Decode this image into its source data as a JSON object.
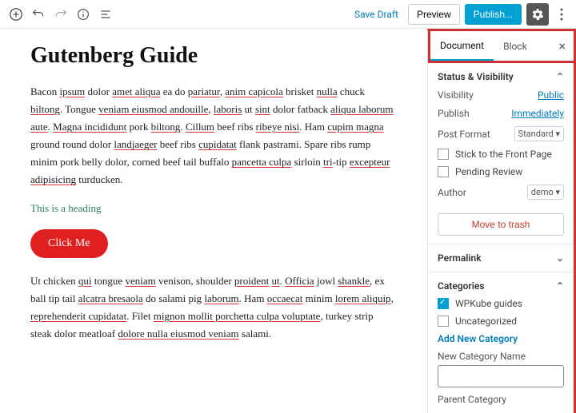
{
  "toolbar": {
    "save_draft": "Save Draft",
    "preview": "Preview",
    "publish": "Publish..."
  },
  "post": {
    "title": "Gutenberg Guide",
    "p1_html": "Bacon <span class='u'>ipsum</span> dolor <span class='u'>amet aliqua</span> ea do <span class='u'>pariatur</span>, <span class='u'>anim capicola</span> brisket <span class='u'>nulla</span> chuck <span class='u'>biltong</span>. Tongue <span class='u'>veniam eiusmod andouille</span>, <span class='u'>laboris</span> ut <span class='u'>sint</span> dolor fatback <span class='u'>aliqua laborum aute</span>. <span class='u'>Magna incididunt</span> pork <span class='u'>biltong</span>. <span class='u'>Cillum</span> beef ribs <span class='u'>ribeye nisi</span>. Ham <span class='u'>cupim magna</span> ground round dolor <span class='u'>landjaeger</span> beef ribs <span class='u'>cupidatat</span> flank pastrami. Spare ribs rump minim pork belly dolor, corned beef tail buffalo <span class='u'>pancetta culpa</span> sirloin <span class='u'>tri</span>-tip <span class='u'>excepteur adipisicing</span> turducken.",
    "heading_text": "This is a heading",
    "button_label": "Click Me",
    "p2_html": "Ut chicken <span class='u'>qui</span> tongue <span class='u'>veniam</span> venison, shoulder <span class='u'>proident</span> <span class='u'>ut</span>. <span class='u'>Officia</span> jowl <span class='u'>shankle</span>, ex ball tip tail <span class='u'>alcatra bresaola</span> do salami pig <span class='u'>laborum</span>. Ham <span class='u'>occaecat</span> minim <span class='u'>lorem aliquip</span>, <span class='u'>reprehenderit cupidatat</span>. Filet <span class='u'>mignon mollit porchetta culpa voluptate</span>, turkey strip steak dolor meatloaf <span class='u'>dolore nulla eiusmod veniam</span> salami."
  },
  "sidebar": {
    "tabs": {
      "document": "Document",
      "block": "Block"
    },
    "status": {
      "title": "Status & Visibility",
      "visibility": "Visibility",
      "visibility_val": "Public",
      "publish": "Publish",
      "publish_val": "Immediately",
      "format": "Post Format",
      "format_val": "Standard",
      "stick": "Stick to the Front Page",
      "pending": "Pending Review",
      "author": "Author",
      "author_val": "demo",
      "trash": "Move to trash"
    },
    "permalink": "Permalink",
    "categories": {
      "title": "Categories",
      "items": [
        "WPKube guides",
        "Uncategorized"
      ],
      "add": "Add New Category",
      "new_label": "New Category Name",
      "parent": "Parent Category"
    }
  }
}
